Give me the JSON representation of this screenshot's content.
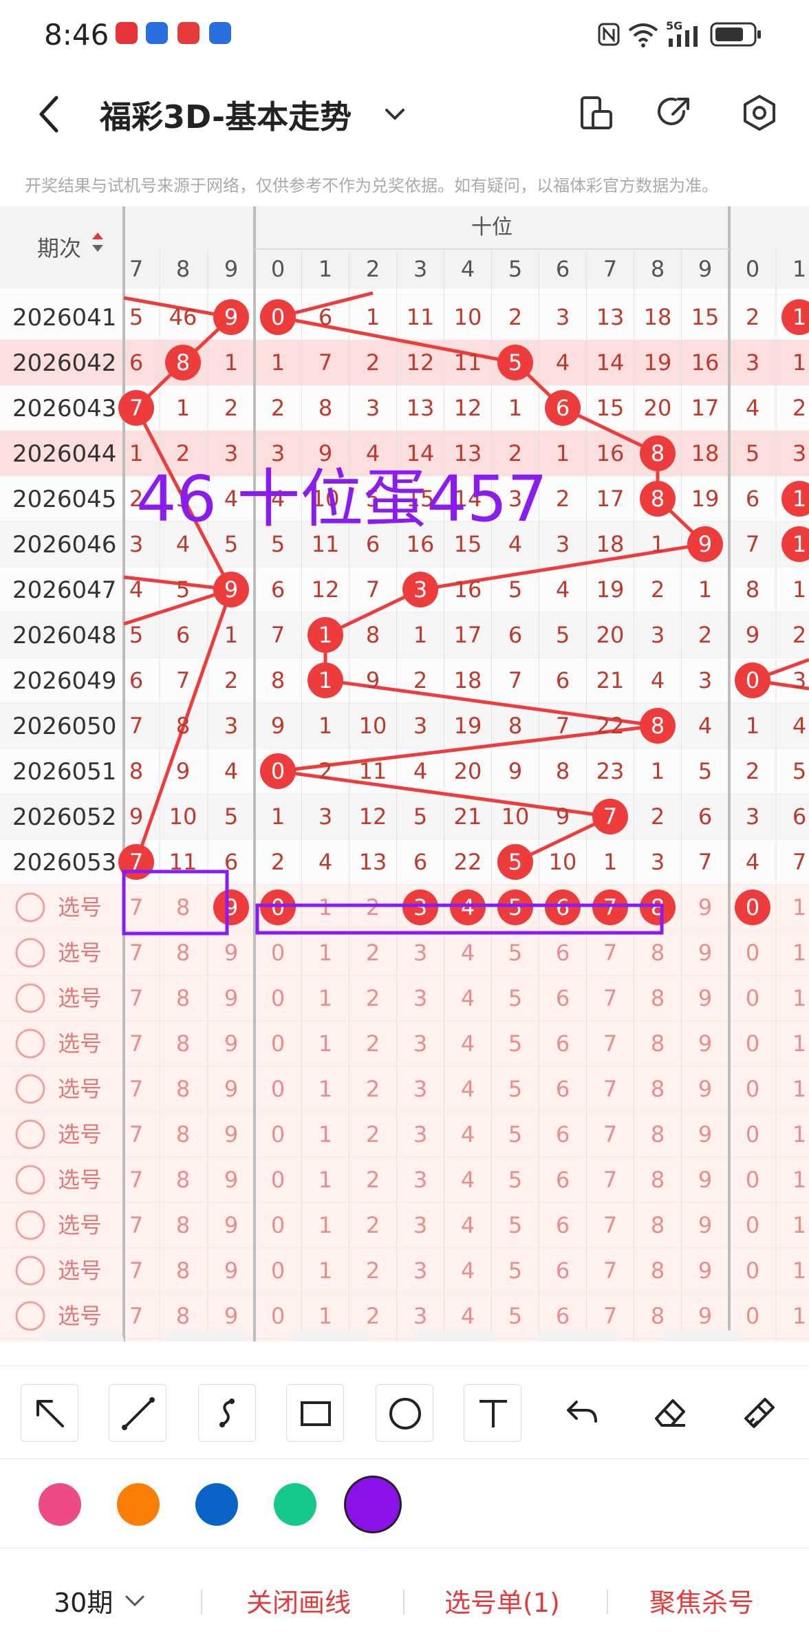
{
  "status_bar": {
    "time": "8:46",
    "signal": "5G"
  },
  "header": {
    "title": "福彩3D-基本走势",
    "back_icon": "back-arrow-icon"
  },
  "disclaimer": "开奖结果与试机号来源于网络，仅供参考不作为兑奖依据。如有疑问，以福体彩官方数据为准。",
  "table": {
    "period_header": "期次",
    "group_header": "十位",
    "left_cols": [
      "7",
      "8",
      "9"
    ],
    "ten_cols": [
      "0",
      "1",
      "2",
      "3",
      "4",
      "5",
      "6",
      "7",
      "8",
      "9"
    ],
    "right_cols": [
      "0",
      "1"
    ],
    "rows": [
      {
        "period": "2026041",
        "left": [
          "5",
          "46",
          "9"
        ],
        "ten": [
          "0",
          "6",
          "1",
          "11",
          "10",
          "2",
          "3",
          "13",
          "18",
          "15"
        ],
        "right": [
          "2",
          "1"
        ],
        "hl": false
      },
      {
        "period": "2026042",
        "left": [
          "6",
          "8",
          "1"
        ],
        "ten": [
          "1",
          "7",
          "2",
          "12",
          "11",
          "5",
          "4",
          "14",
          "19",
          "16"
        ],
        "right": [
          "3",
          "1"
        ],
        "hl": true
      },
      {
        "period": "2026043",
        "left": [
          "7",
          "1",
          "2"
        ],
        "ten": [
          "2",
          "8",
          "3",
          "13",
          "12",
          "1",
          "6",
          "15",
          "20",
          "17"
        ],
        "right": [
          "4",
          "2"
        ],
        "hl": false
      },
      {
        "period": "2026044",
        "left": [
          "1",
          "2",
          "3"
        ],
        "ten": [
          "3",
          "9",
          "4",
          "14",
          "13",
          "2",
          "1",
          "16",
          "8",
          "18"
        ],
        "right": [
          "5",
          "3"
        ],
        "hl": true
      },
      {
        "period": "2026045",
        "left": [
          "2",
          "3",
          "4"
        ],
        "ten": [
          "4",
          "10",
          "5",
          "15",
          "14",
          "3",
          "2",
          "17",
          "8",
          "19"
        ],
        "right": [
          "6",
          "1"
        ],
        "hl": false
      },
      {
        "period": "2026046",
        "left": [
          "3",
          "4",
          "5"
        ],
        "ten": [
          "5",
          "11",
          "6",
          "16",
          "15",
          "4",
          "3",
          "18",
          "1",
          "9"
        ],
        "right": [
          "7",
          "1"
        ],
        "hl": false
      },
      {
        "period": "2026047",
        "left": [
          "4",
          "5",
          "9"
        ],
        "ten": [
          "6",
          "12",
          "7",
          "3",
          "16",
          "5",
          "4",
          "19",
          "2",
          "1"
        ],
        "right": [
          "8",
          "1"
        ],
        "hl": false
      },
      {
        "period": "2026048",
        "left": [
          "5",
          "6",
          "1"
        ],
        "ten": [
          "7",
          "1",
          "8",
          "1",
          "17",
          "6",
          "5",
          "20",
          "3",
          "2"
        ],
        "right": [
          "9",
          "2"
        ],
        "hl": false
      },
      {
        "period": "2026049",
        "left": [
          "6",
          "7",
          "2"
        ],
        "ten": [
          "8",
          "1",
          "9",
          "2",
          "18",
          "7",
          "6",
          "21",
          "4",
          "3"
        ],
        "right": [
          "0",
          "3"
        ],
        "hl": false
      },
      {
        "period": "2026050",
        "left": [
          "7",
          "8",
          "3"
        ],
        "ten": [
          "9",
          "1",
          "10",
          "3",
          "19",
          "8",
          "7",
          "22",
          "8",
          "4"
        ],
        "right": [
          "1",
          "4"
        ],
        "hl": false
      },
      {
        "period": "2026051",
        "left": [
          "8",
          "9",
          "4"
        ],
        "ten": [
          "0",
          "2",
          "11",
          "4",
          "20",
          "9",
          "8",
          "23",
          "1",
          "5"
        ],
        "right": [
          "2",
          "5"
        ],
        "hl": false
      },
      {
        "period": "2026052",
        "left": [
          "9",
          "10",
          "5"
        ],
        "ten": [
          "1",
          "3",
          "12",
          "5",
          "21",
          "10",
          "9",
          "7",
          "2",
          "6"
        ],
        "right": [
          "3",
          "6"
        ],
        "hl": false
      },
      {
        "period": "2026053",
        "left": [
          "7",
          "11",
          "6"
        ],
        "ten": [
          "2",
          "4",
          "13",
          "6",
          "22",
          "5",
          "10",
          "1",
          "3",
          "7"
        ],
        "right": [
          "4",
          "7"
        ],
        "hl": false
      }
    ],
    "pick_label": "选号",
    "pick_row_count": 10
  },
  "annotation": {
    "text": "46  十位蛋457",
    "color": "#8a1cf0"
  },
  "toolbar": {
    "tools": [
      "arrow-tool-icon",
      "line-tool-icon",
      "curve-tool-icon",
      "rectangle-tool-icon",
      "circle-tool-icon",
      "text-tool-icon",
      "undo-icon",
      "eraser-icon",
      "clear-brush-icon"
    ]
  },
  "colors": {
    "swatches": [
      "#ee4a86",
      "#fb7d06",
      "#0a64c8",
      "#16c88a",
      "#8a12e8"
    ],
    "selected": "#8a12e8",
    "ball": "#ee3b3b",
    "annotation": "#8a1cf0"
  },
  "bottom_bar": {
    "periods": "30期",
    "close_lines": "关闭画线",
    "pick_list": "选号单(1)",
    "focus_kill": "聚焦杀号"
  }
}
